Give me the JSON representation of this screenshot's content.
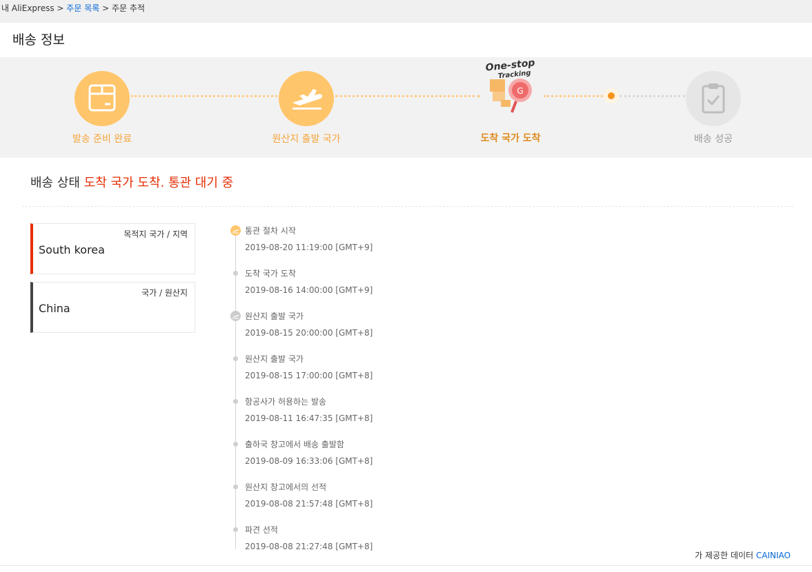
{
  "breadcrumb": {
    "prefix": "내 AliExpress >",
    "link": "주문 목록",
    "sep": ">",
    "current": "주문 추적"
  },
  "panel": {
    "title": "배송 정보"
  },
  "steps": [
    {
      "label": "발송 준비 완료",
      "icon": "box-icon",
      "state": "done"
    },
    {
      "label": "원산지 출발 국가",
      "icon": "plane-departure-icon",
      "state": "done"
    },
    {
      "label": "도착 국가 도착",
      "icon": "one-stop-tracking-icon",
      "state": "active"
    },
    {
      "label": "배송 성공",
      "icon": "clipboard-check-icon",
      "state": "pending"
    }
  ],
  "onestop": {
    "line1": "One-stop",
    "line2": "Tracking"
  },
  "status": {
    "label": "배송 상태",
    "value": "도착 국가 도착. 통관 대기 중"
  },
  "destination": {
    "caption": "목적지 국가 / 지역",
    "value": "South korea"
  },
  "origin": {
    "caption": "국가 / 원산지",
    "value": "China"
  },
  "timeline": [
    {
      "event": "통관 절차 시작",
      "time": "2019-08-20 11:19:00 [GMT+9]",
      "marker": "plane-icon-orange"
    },
    {
      "event": "도착 국가 도착",
      "time": "2019-08-16 14:00:00 [GMT+9]",
      "marker": "dot"
    },
    {
      "event": "원산지 출발 국가",
      "time": "2019-08-15 20:00:00 [GMT+8]",
      "marker": "plane-icon-grey"
    },
    {
      "event": "원산지 출발 국가",
      "time": "2019-08-15 17:00:00 [GMT+8]",
      "marker": "dot"
    },
    {
      "event": "항공사가 허용하는 발송",
      "time": "2019-08-11 16:47:35 [GMT+8]",
      "marker": "dot"
    },
    {
      "event": "출하국 창고에서 배송 출발함",
      "time": "2019-08-09 16:33:06 [GMT+8]",
      "marker": "dot"
    },
    {
      "event": "원산지 창고에서의 선적",
      "time": "2019-08-08 21:57:48 [GMT+8]",
      "marker": "dot"
    },
    {
      "event": "파견 선적",
      "time": "2019-08-08 21:27:48 [GMT+8]",
      "marker": "dot"
    }
  ],
  "provider": {
    "text": "가 제공한 데이터",
    "link": "CAINIAO"
  },
  "colors": {
    "accent": "#e62e04",
    "step_orange": "#ffc56b",
    "link": "#0366d6"
  }
}
